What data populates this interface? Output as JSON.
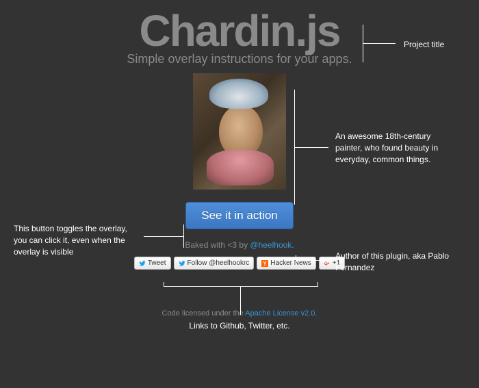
{
  "title": "Chardin.js",
  "subtitle": "Simple overlay instructions for your apps.",
  "cta_label": "See it in action",
  "credit": {
    "prefix": "Baked with <3 by ",
    "handle": "@heelhook",
    "suffix": "."
  },
  "social": {
    "tweet": "Tweet",
    "follow": "Follow @heelhookrc",
    "hn": "Hacker News",
    "gplus": "+1"
  },
  "license": {
    "prefix": "Code licensed under the ",
    "link": "Apache License v2.0",
    "suffix": "."
  },
  "annotations": {
    "project_title": "Project title",
    "portrait": "An awesome 18th-century painter, who found beauty in everyday, common things.",
    "button": "This button toggles the overlay, you can click it, even when the overlay is visible",
    "author": "Author of this plugin, aka Pablo Fernandez",
    "links": "Links to Github, Twitter, etc."
  }
}
